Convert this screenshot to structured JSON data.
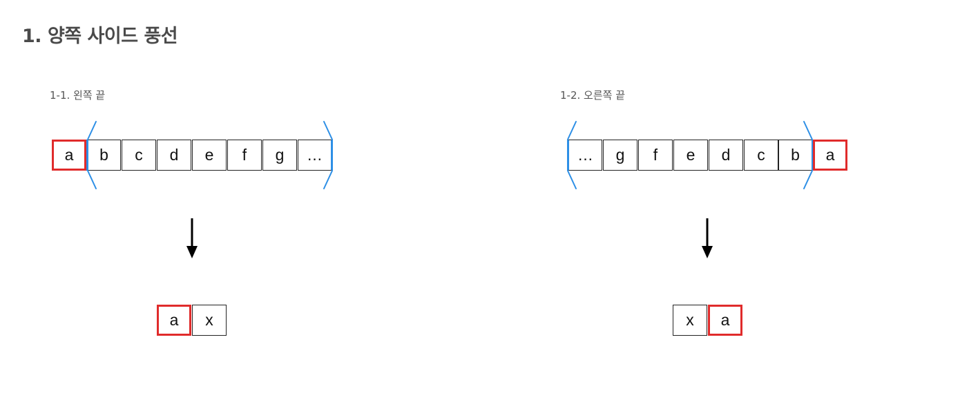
{
  "title": "1. 양쪽 사이드 풍선",
  "sections": [
    {
      "title": "1-1. 왼쪽 끝",
      "top_cells": [
        "a",
        "b",
        "c",
        "d",
        "e",
        "f",
        "g",
        "…"
      ],
      "bottom_cells": [
        "a",
        "x"
      ]
    },
    {
      "title": "1-2. 오른쪽 끝",
      "top_cells": [
        "…",
        "g",
        "f",
        "e",
        "d",
        "c",
        "b",
        "a"
      ],
      "bottom_cells": [
        "x",
        "a"
      ]
    }
  ],
  "colors": {
    "highlight": "#e02b2b",
    "bracket": "#2d8fe6",
    "arrow": "#000000"
  }
}
